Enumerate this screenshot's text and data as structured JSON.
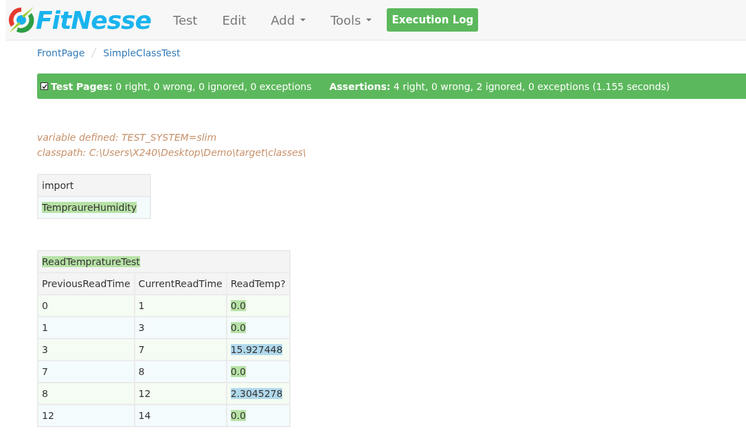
{
  "header": {
    "logo": "FitNesse",
    "nav": [
      {
        "label": "Test",
        "dropdown": false
      },
      {
        "label": "Edit",
        "dropdown": false
      },
      {
        "label": "Add",
        "dropdown": true
      },
      {
        "label": "Tools",
        "dropdown": true
      }
    ],
    "button": "Execution Log"
  },
  "breadcrumb": [
    "FrontPage",
    "SimpleClassTest"
  ],
  "summary": {
    "passed": true,
    "test_pages": "**Test Pages:** 0 right, 0 wrong, 0 ignored, 0 exceptions",
    "assertions": "**Assertions:** 4 right, 0 wrong, 2 ignored, 0 exceptions (1.155 seconds)"
  },
  "notes": [
    "variable defined: TEST_SYSTEM=slim",
    "classpath: C:\\Users\\X240\\Desktop\\Demo\\target\\classes\\"
  ],
  "import_table": {
    "title": "import",
    "rows": [
      {
        "text": "TempraureHumidity",
        "passed": true
      }
    ]
  },
  "decision_table": {
    "title": "ReadTempratureTest",
    "title_passed": true,
    "columns": [
      "PreviousReadTime",
      "CurrentReadTime",
      "ReadTemp?"
    ],
    "rows": [
      {
        "cells": [
          "0",
          "1"
        ],
        "value": "0.0",
        "ignored": false
      },
      {
        "cells": [
          "1",
          "3"
        ],
        "value": "0.0",
        "ignored": false
      },
      {
        "cells": [
          "3",
          "7"
        ],
        "value": "15.927448",
        "ignored": true
      },
      {
        "cells": [
          "7",
          "8"
        ],
        "value": "0.0",
        "ignored": false
      },
      {
        "cells": [
          "8",
          "12"
        ],
        "value": "2.3045278",
        "ignored": true
      },
      {
        "cells": [
          "12",
          "14"
        ],
        "value": "0.0",
        "ignored": false
      }
    ]
  }
}
